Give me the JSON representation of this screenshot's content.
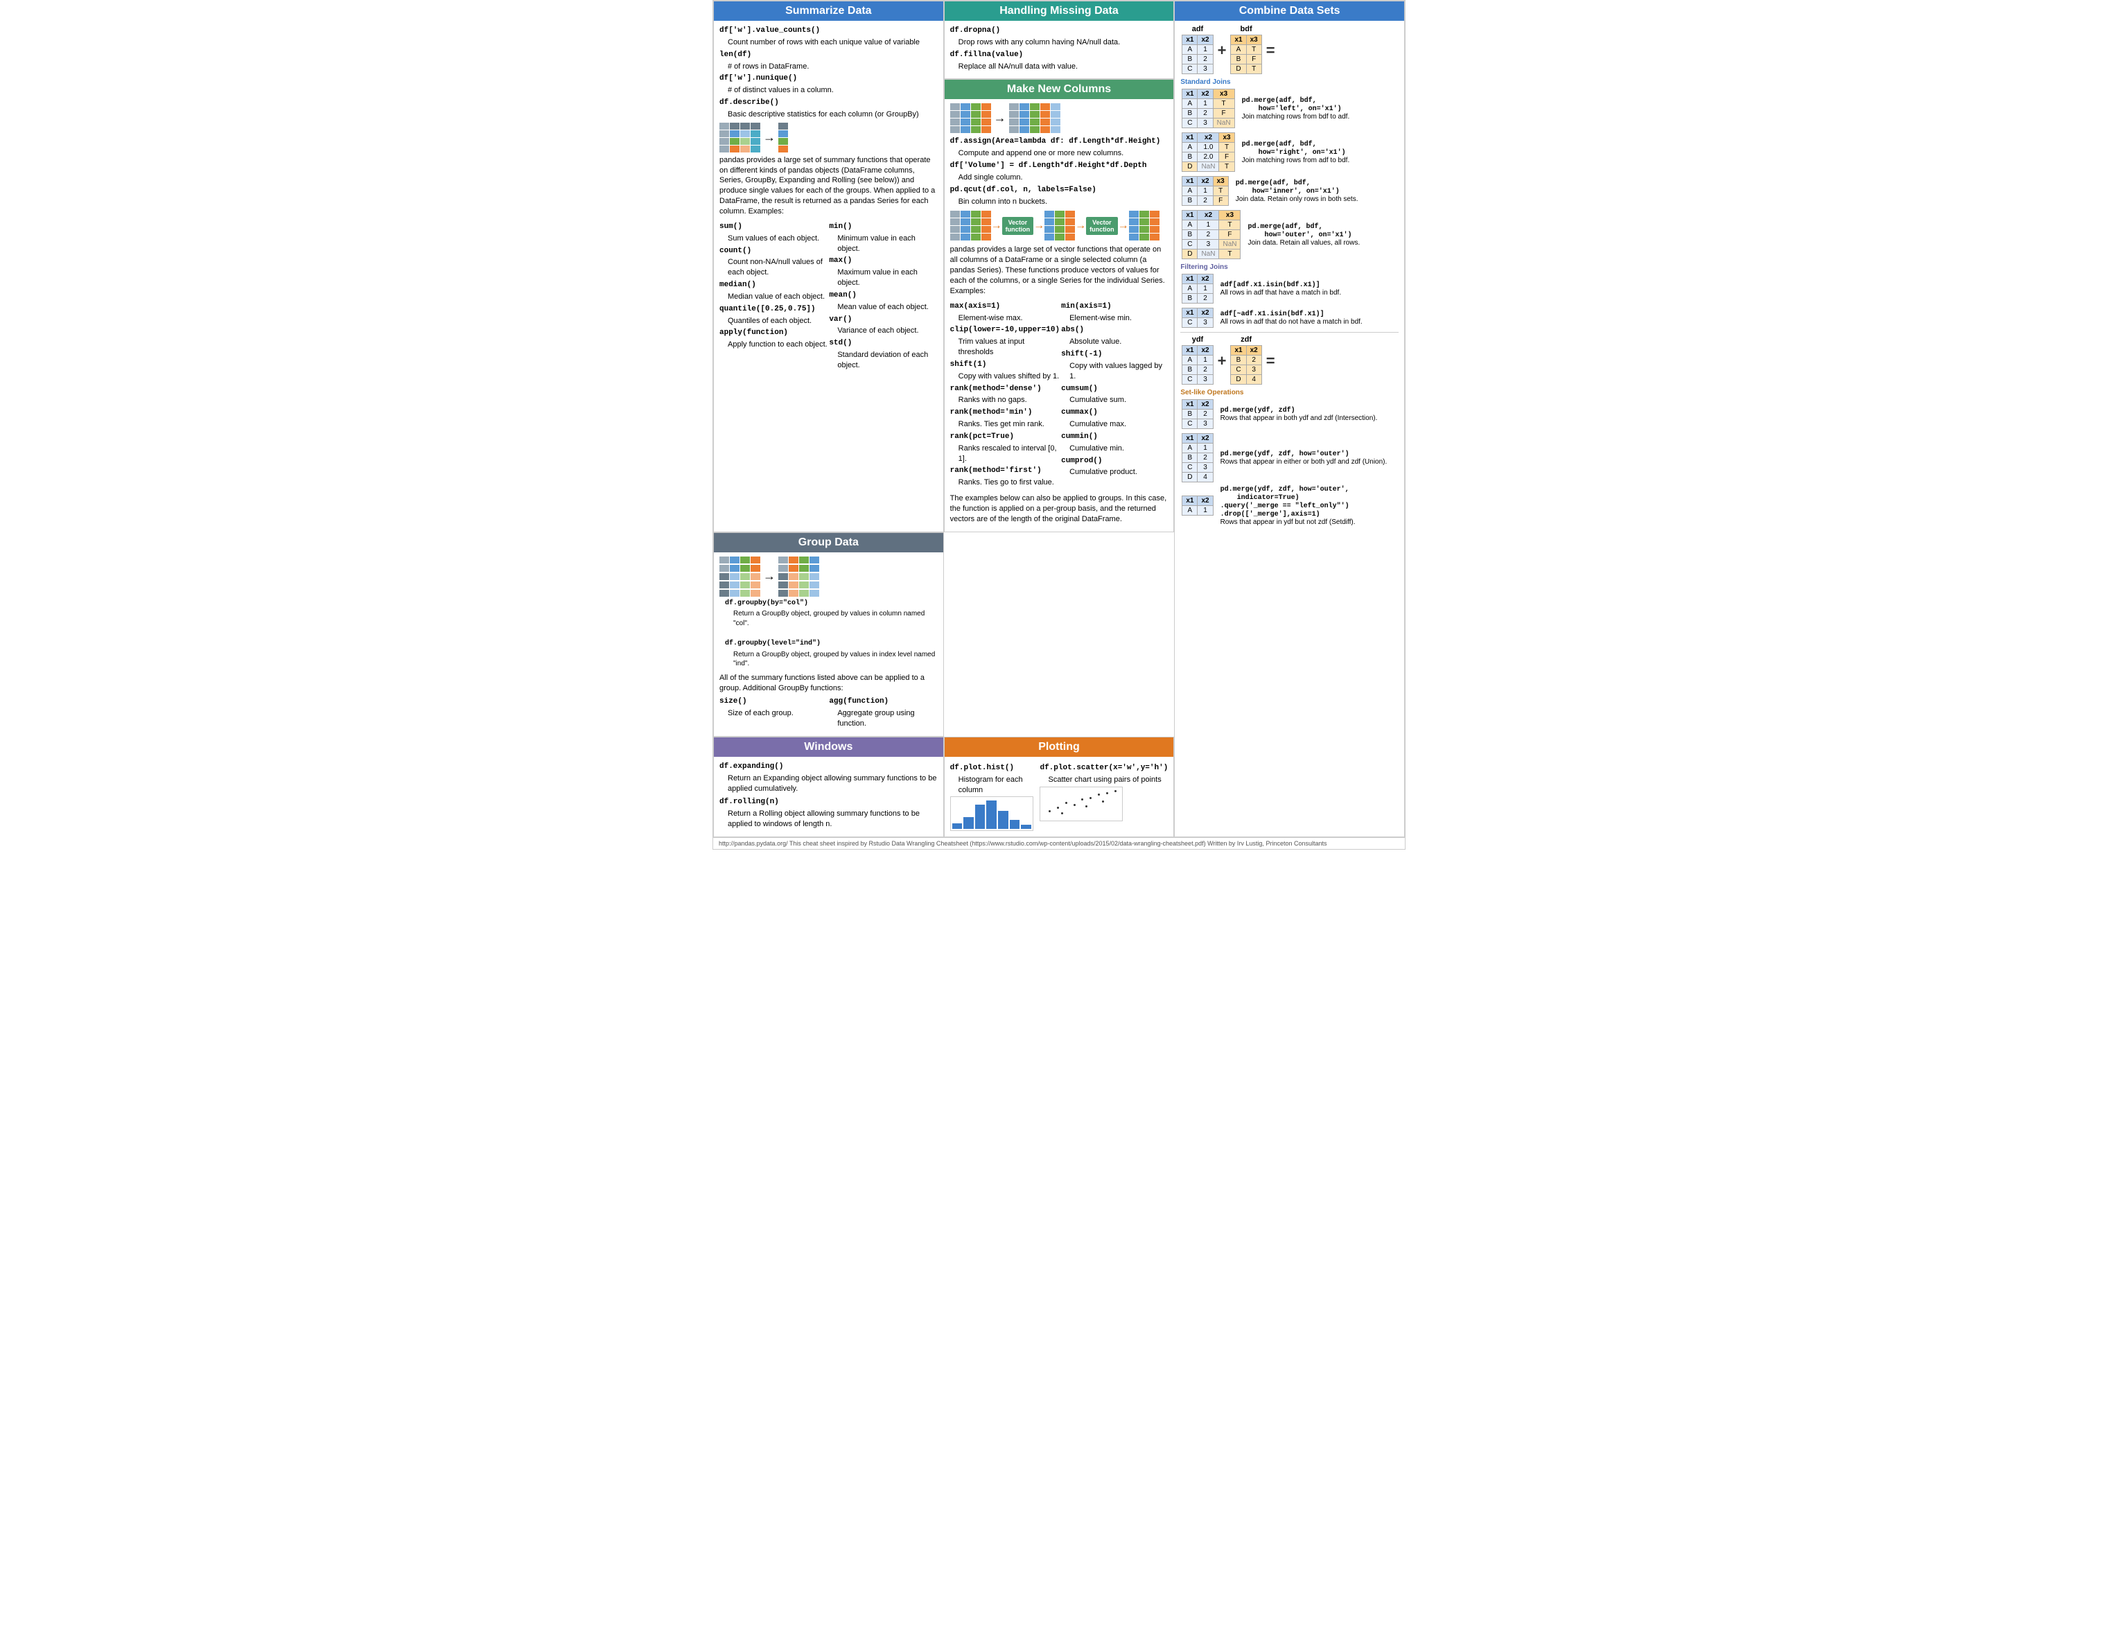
{
  "summarize": {
    "title": "Summarize Data",
    "items": [
      {
        "code": "df['w'].value_counts()",
        "desc": "Count number of rows with each unique value of variable"
      },
      {
        "code": "len(df)",
        "desc": "# of rows in DataFrame."
      },
      {
        "code": "df['w'].nunique()",
        "desc": "# of distinct values in a column."
      },
      {
        "code": "df.describe()",
        "desc": "Basic descriptive statistics for each column (or GroupBy)"
      }
    ],
    "paragraph": "pandas provides a large set of summary functions that operate on different kinds of pandas objects (DataFrame columns, Series, GroupBy, Expanding and Rolling (see below)) and produce single values for each of the groups. When applied to a DataFrame, the result is returned as a pandas Series for each column. Examples:",
    "functions_left": [
      {
        "code": "sum()",
        "desc": "Sum values of each object."
      },
      {
        "code": "count()",
        "desc": "Count non-NA/null values of each object."
      },
      {
        "code": "median()",
        "desc": "Median value of each object."
      },
      {
        "code": "quantile([0.25,0.75])",
        "desc": "Quantiles of each object."
      },
      {
        "code": "apply(function)",
        "desc": "Apply function to each object."
      }
    ],
    "functions_right": [
      {
        "code": "min()",
        "desc": "Minimum value in each object."
      },
      {
        "code": "max()",
        "desc": "Maximum value in each object."
      },
      {
        "code": "mean()",
        "desc": "Mean value of each object."
      },
      {
        "code": "var()",
        "desc": "Variance of each object."
      },
      {
        "code": "std()",
        "desc": "Standard deviation of each object."
      }
    ]
  },
  "missing": {
    "title": "Handling Missing Data",
    "items": [
      {
        "code": "df.dropna()",
        "desc": "Drop rows with any column having NA/null data."
      },
      {
        "code": "df.fillna(value)",
        "desc": "Replace all NA/null data with value."
      }
    ]
  },
  "newcols": {
    "title": "Make New Columns",
    "items": [
      {
        "code": "df.assign(Area=lambda df: df.Length*df.Height)",
        "desc": "Compute and append one or more new columns."
      },
      {
        "code": "df['Volume'] = df.Length*df.Height*df.Depth",
        "desc": "Add single column."
      },
      {
        "code": "pd.qcut(df.col, n, labels=False)",
        "desc": "Bin column into n buckets."
      }
    ],
    "paragraph": "pandas provides a large set of vector functions that operate on all columns of a DataFrame or a single selected column (a pandas Series). These functions produce vectors of values for each of the columns, or a single Series for the individual Series. Examples:",
    "functions_left": [
      {
        "code": "max(axis=1)",
        "desc": "Element-wise max."
      },
      {
        "code": "clip(lower=-10,upper=10)",
        "desc": "Trim values at input thresholds"
      },
      {
        "code": "shift(1)",
        "desc": "Copy with values shifted by 1."
      },
      {
        "code": "rank(method='dense')",
        "desc": "Ranks with no gaps."
      },
      {
        "code": "rank(method='min')",
        "desc": "Ranks. Ties get min rank."
      },
      {
        "code": "rank(pct=True)",
        "desc": "Ranks rescaled to interval [0, 1]."
      },
      {
        "code": "rank(method='first')",
        "desc": "Ranks. Ties go to first value."
      }
    ],
    "functions_right": [
      {
        "code": "min(axis=1)",
        "desc": "Element-wise min."
      },
      {
        "code": "abs()",
        "desc": "Absolute value."
      },
      {
        "code": "shift(-1)",
        "desc": "Copy with values lagged by 1."
      },
      {
        "code": "cumsum()",
        "desc": "Cumulative sum."
      },
      {
        "code": "cummax()",
        "desc": "Cumulative max."
      },
      {
        "code": "cummin()",
        "desc": "Cumulative min."
      },
      {
        "code": "cumprod()",
        "desc": "Cumulative product."
      }
    ],
    "group_note": "The examples below can also be applied to groups. In this case, the function is applied on a per-group basis, and the returned vectors are of the length of the original DataFrame."
  },
  "combine": {
    "title": "Combine Data Sets",
    "standard_joins_title": "Standard Joins",
    "filtering_joins_title": "Filtering Joins",
    "set_ops_title": "Set-like Operations",
    "joins": [
      {
        "code": "pd.merge(adf, bdf,\n    how='left', on='x1')",
        "desc": "Join matching rows from bdf to adf.",
        "result": [
          [
            "x1",
            "x2",
            "x3"
          ],
          [
            "A",
            "1",
            "T"
          ],
          [
            "B",
            "2",
            "F"
          ],
          [
            "C",
            "3",
            "NaN"
          ]
        ]
      },
      {
        "code": "pd.merge(adf, bdf,\n    how='right', on='x1')",
        "desc": "Join matching rows from adf to bdf.",
        "result": [
          [
            "x1",
            "x2",
            "x3"
          ],
          [
            "A",
            "1.0",
            "T"
          ],
          [
            "B",
            "2.0",
            "F"
          ],
          [
            "D",
            "NaN",
            "T"
          ]
        ]
      },
      {
        "code": "pd.merge(adf, bdf,\n    how='inner', on='x1')",
        "desc": "Join data. Retain only rows in both sets.",
        "result": [
          [
            "x1",
            "x2",
            "x3"
          ],
          [
            "A",
            "1",
            "T"
          ],
          [
            "B",
            "2",
            "F"
          ]
        ]
      },
      {
        "code": "pd.merge(adf, bdf,\n    how='outer', on='x1')",
        "desc": "Join data. Retain all values, all rows.",
        "result": [
          [
            "x1",
            "x2",
            "x3"
          ],
          [
            "A",
            "1",
            "T"
          ],
          [
            "B",
            "2",
            "F"
          ],
          [
            "C",
            "3",
            "NaN"
          ],
          [
            "D",
            "NaN",
            "T"
          ]
        ]
      }
    ],
    "filter_joins": [
      {
        "code": "adf[adf.x1.isin(bdf.x1)]",
        "desc": "All rows in adf that have a match in bdf.",
        "result": [
          [
            "x1",
            "x2"
          ],
          [
            "A",
            "1"
          ],
          [
            "B",
            "2"
          ]
        ]
      },
      {
        "code": "adf[~adf.x1.isin(bdf.x1)]",
        "desc": "All rows in adf that do not have a match in bdf.",
        "result": [
          [
            "x1",
            "x2"
          ],
          [
            "C",
            "3"
          ]
        ]
      }
    ],
    "set_ops": [
      {
        "code": "pd.merge(ydf, zdf)",
        "desc": "Rows that appear in both ydf and zdf (Intersection).",
        "result": [
          [
            "x1",
            "x2"
          ],
          [
            "B",
            "2"
          ],
          [
            "C",
            "3"
          ]
        ]
      },
      {
        "code": "pd.merge(ydf, zdf, how='outer')",
        "desc": "Rows that appear in either or both ydf and zdf (Union).",
        "result": [
          [
            "x1",
            "x2"
          ],
          [
            "A",
            "1"
          ],
          [
            "B",
            "2"
          ],
          [
            "C",
            "3"
          ],
          [
            "D",
            "4"
          ]
        ]
      },
      {
        "code": "pd.merge(ydf, zdf, how='outer',\n    indicator=True)\n.query('_merge == \"left_only\"')\n.drop(['_merge'],axis=1)",
        "desc": "Rows that appear in ydf but not zdf (Setdiff).",
        "result": [
          [
            "x1",
            "x2"
          ],
          [
            "A",
            "1"
          ]
        ]
      }
    ]
  },
  "groupdata": {
    "title": "Group Data",
    "items": [
      {
        "code": "df.groupby(by=\"col\")",
        "desc": "Return a GroupBy object, grouped by values in column named \"col\"."
      },
      {
        "code": "df.groupby(level=\"ind\")",
        "desc": "Return a GroupBy object, grouped by values in index level named \"ind\"."
      }
    ],
    "note": "All of the summary functions listed above can be applied to a group. Additional GroupBy functions:",
    "extra_left": {
      "code": "size()",
      "desc": "Size of each group."
    },
    "extra_right": {
      "code": "agg(function)",
      "desc": "Aggregate group using function."
    }
  },
  "windows": {
    "title": "Windows",
    "items": [
      {
        "code": "df.expanding()",
        "desc": "Return an Expanding object allowing summary functions to be applied cumulatively."
      },
      {
        "code": "df.rolling(n)",
        "desc": "Return a Rolling object allowing summary functions to be applied to windows of length n."
      }
    ]
  },
  "plotting": {
    "title": "Plotting",
    "items": [
      {
        "code": "df.plot.hist()",
        "desc": "Histogram for each column"
      },
      {
        "code": "df.plot.scatter(x='w',y='h')",
        "desc": "Scatter chart using pairs of points"
      }
    ]
  },
  "footer": {
    "text": "http://pandas.pydata.org/  This cheat sheet inspired by Rstudio Data Wrangling Cheatsheet (https://www.rstudio.com/wp-content/uploads/2015/02/data-wrangling-cheatsheet.pdf) Written by Irv Lustig,  Princeton Consultants"
  }
}
